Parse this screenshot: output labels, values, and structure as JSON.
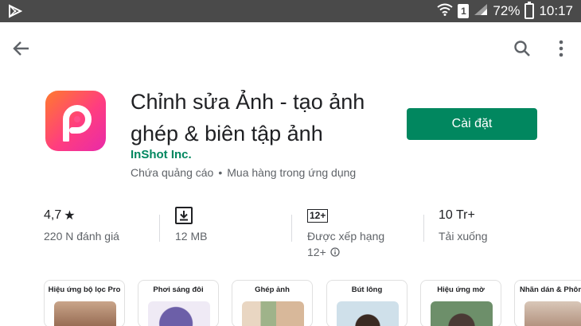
{
  "status_bar": {
    "battery": "72%",
    "time": "10:17",
    "sim_label": "1"
  },
  "app_bar": {
    "back_icon": "arrow-left-icon",
    "search_icon": "search-icon",
    "more_icon": "more-vert-icon"
  },
  "app": {
    "title": "Chỉnh sửa Ảnh - tạo ảnh ghép & biên tập ảnh",
    "developer": "InShot Inc.",
    "contains_ads": "Chứa quảng cáo",
    "bullet": "•",
    "in_app_purchases": "Mua hàng trong ứng dụng",
    "install_label": "Cài đặt",
    "accent_color": "#01875f"
  },
  "stats": {
    "rating": "4,7",
    "rating_star": "★",
    "reviews": "220 N đánh giá",
    "size": "12 MB",
    "content_badge": "12+",
    "content_label": "Được xếp hạng",
    "content_value": "12+",
    "downloads": "10 Tr+",
    "downloads_label": "Tải xuống"
  },
  "screenshots": [
    {
      "caption": "Hiệu ứng bộ lọc Pro"
    },
    {
      "caption": "Phơi sáng đôi"
    },
    {
      "caption": "Ghép ảnh"
    },
    {
      "caption": "Bút lông"
    },
    {
      "caption": "Hiệu ứng mờ"
    },
    {
      "caption": "Nhãn dán & Phông"
    }
  ]
}
